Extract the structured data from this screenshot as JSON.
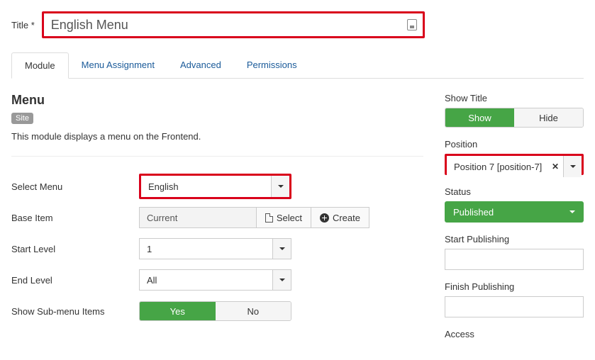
{
  "title": {
    "label": "Title *",
    "value": "English Menu"
  },
  "tabs": {
    "module": "Module",
    "menu_assignment": "Menu Assignment",
    "advanced": "Advanced",
    "permissions": "Permissions"
  },
  "main": {
    "heading": "Menu",
    "site_badge": "Site",
    "description": "This module displays a menu on the Frontend.",
    "select_menu": {
      "label": "Select Menu",
      "value": "English"
    },
    "base_item": {
      "label": "Base Item",
      "value": "Current",
      "select_btn": "Select",
      "create_btn": "Create"
    },
    "start_level": {
      "label": "Start Level",
      "value": "1"
    },
    "end_level": {
      "label": "End Level",
      "value": "All"
    },
    "show_submenu": {
      "label": "Show Sub-menu Items",
      "yes": "Yes",
      "no": "No"
    }
  },
  "sidebar": {
    "show_title": {
      "label": "Show Title",
      "show": "Show",
      "hide": "Hide"
    },
    "position": {
      "label": "Position",
      "value": "Position 7 [position-7]"
    },
    "status": {
      "label": "Status",
      "value": "Published"
    },
    "start_publishing": {
      "label": "Start Publishing",
      "value": ""
    },
    "finish_publishing": {
      "label": "Finish Publishing",
      "value": ""
    },
    "access": {
      "label": "Access"
    }
  }
}
